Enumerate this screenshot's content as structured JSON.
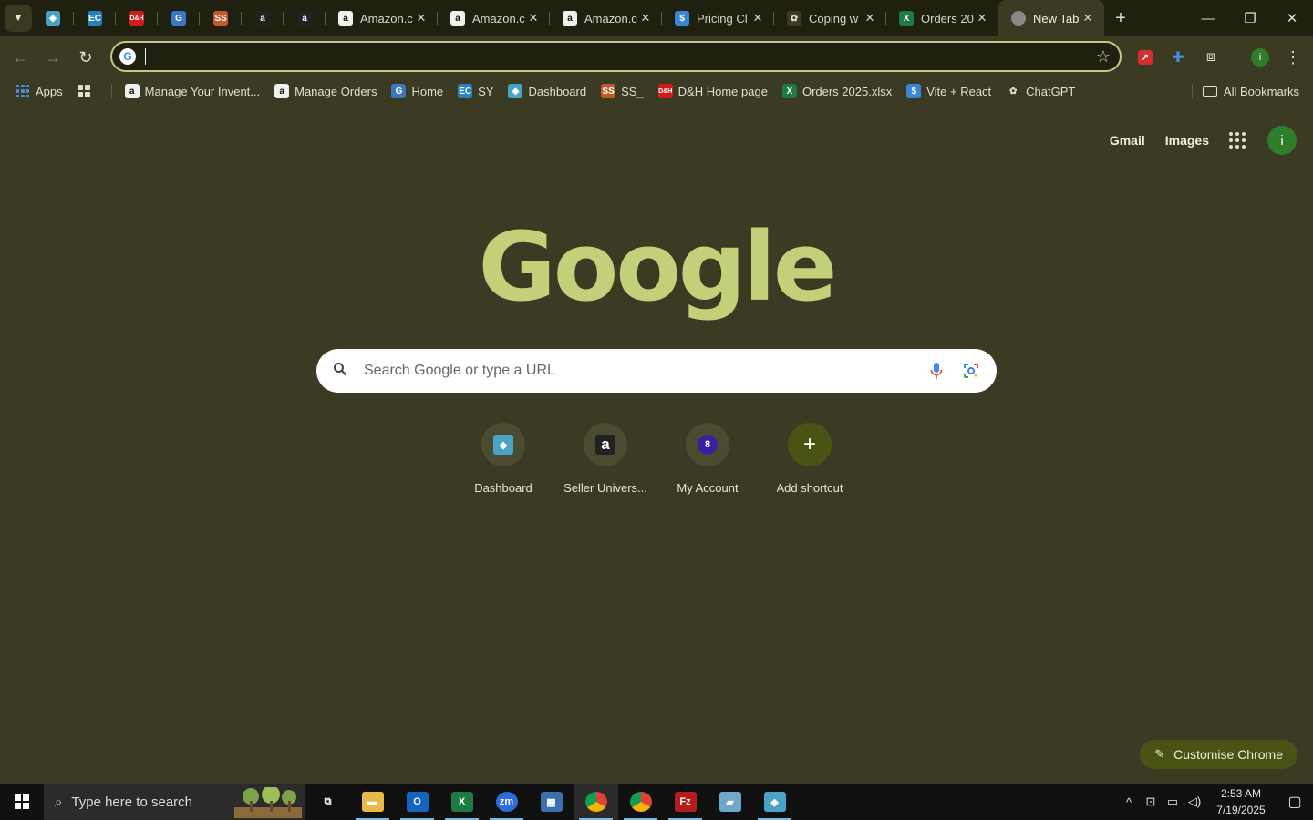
{
  "tabs": {
    "pinned": [
      {
        "icon": "dashboard-diamond-icon",
        "glyph": "◆",
        "color": "#4aa3c7"
      },
      {
        "icon": "ec-icon",
        "glyph": "EC",
        "color": "#2a7fc1"
      },
      {
        "icon": "dh-icon",
        "glyph": "D&H",
        "color": "#d01c1c"
      },
      {
        "icon": "home-g-icon",
        "glyph": "G",
        "color": "#3a78c3"
      },
      {
        "icon": "ss-icon",
        "glyph": "SS",
        "color": "#c05a2a"
      },
      {
        "icon": "amazon-icon",
        "glyph": "a",
        "color": "#222222"
      },
      {
        "icon": "amazon-icon",
        "glyph": "a",
        "color": "#222222"
      }
    ],
    "open": [
      {
        "title": "Amazon.c",
        "icon": "amazon-icon",
        "glyph": "a",
        "color": "#f0f0f0",
        "close": "✕"
      },
      {
        "title": "Amazon.c",
        "icon": "amazon-icon",
        "glyph": "a",
        "color": "#f0f0f0",
        "close": "✕"
      },
      {
        "title": "Amazon.c",
        "icon": "amazon-icon",
        "glyph": "a",
        "color": "#f0f0f0",
        "close": "✕"
      },
      {
        "title": "Pricing Cl",
        "icon": "dollar-icon",
        "glyph": "$",
        "color": "#3a86d6",
        "close": "✕"
      },
      {
        "title": "Coping w",
        "icon": "chatgpt-icon",
        "glyph": "✿",
        "color": "#3b3b24",
        "close": "✕"
      },
      {
        "title": "Orders 20",
        "icon": "excel-icon",
        "glyph": "X",
        "color": "#1f7a43",
        "close": "✕"
      }
    ],
    "active": {
      "title": "New Tab",
      "icon": "chrome-icon",
      "close": "✕"
    },
    "new_tab": "+"
  },
  "window": {
    "minimize": "—",
    "restore": "❐",
    "close": "✕"
  },
  "toolbar": {
    "back": "←",
    "forward": "→",
    "reload": "↻",
    "omnibox_value": "",
    "star": "☆"
  },
  "bookmarks": [
    {
      "label": "Apps",
      "type": "apps"
    },
    {
      "label": "",
      "type": "grid"
    },
    {
      "label": "Manage Your Invent...",
      "icon": "amazon-icon",
      "glyph": "a",
      "color": "#f0f0f0"
    },
    {
      "label": "Manage Orders",
      "icon": "amazon-icon",
      "glyph": "a",
      "color": "#f0f0f0"
    },
    {
      "label": "Home",
      "icon": "home-g-icon",
      "glyph": "G",
      "color": "#3a78c3"
    },
    {
      "label": "SY",
      "icon": "ec-icon",
      "glyph": "EC",
      "color": "#2a7fc1"
    },
    {
      "label": "Dashboard",
      "icon": "dashboard-diamond-icon",
      "glyph": "◆",
      "color": "#4aa3c7"
    },
    {
      "label": "SS_",
      "icon": "ss-icon",
      "glyph": "SS",
      "color": "#c05a2a"
    },
    {
      "label": "D&H Home page",
      "icon": "dh-icon",
      "glyph": "D&H",
      "color": "#d01c1c"
    },
    {
      "label": "Orders 2025.xlsx",
      "icon": "excel-icon",
      "glyph": "X",
      "color": "#1f7a43"
    },
    {
      "label": "Vite + React",
      "icon": "dollar-icon",
      "glyph": "$",
      "color": "#3a86d6"
    },
    {
      "label": "ChatGPT",
      "icon": "chatgpt-icon",
      "glyph": "✿",
      "color": "#3b3b24"
    }
  ],
  "all_bookmarks": "All Bookmarks",
  "header_links": {
    "gmail": "Gmail",
    "images": "Images",
    "avatar": "i"
  },
  "logo": "Google",
  "search": {
    "placeholder": "Search Google or type a URL"
  },
  "shortcuts": [
    {
      "label": "Dashboard",
      "icon": "dashboard-diamond-icon",
      "glyph": "◆",
      "color": "#4aa3c7"
    },
    {
      "label": "Seller Univers...",
      "icon": "amazon-icon",
      "glyph": "a",
      "color": "#222222"
    },
    {
      "label": "My Account",
      "icon": "account-8-icon",
      "glyph": "8",
      "color": "#3a1fa0"
    },
    {
      "label": "Add shortcut",
      "icon": "plus-icon",
      "glyph": "+",
      "color": "#4a5214"
    }
  ],
  "customise": "Customise Chrome",
  "taskbar": {
    "search_placeholder": "Type here to search",
    "apps": [
      {
        "icon": "task-view-icon",
        "glyph": "⧉",
        "color": "#101010"
      },
      {
        "icon": "file-explorer-icon",
        "glyph": "▬",
        "color": "#e8b84a"
      },
      {
        "icon": "outlook-icon",
        "glyph": "O",
        "color": "#1565c0"
      },
      {
        "icon": "excel-icon",
        "glyph": "X",
        "color": "#1f7a43"
      },
      {
        "icon": "zoom-icon",
        "glyph": "zm",
        "color": "#2d6cdf"
      },
      {
        "icon": "calculator-icon",
        "glyph": "▦",
        "color": "#3a6fb0"
      },
      {
        "icon": "chrome-icon",
        "glyph": "◉",
        "color": "#d93025"
      },
      {
        "icon": "chrome-icon",
        "glyph": "◉",
        "color": "#d93025"
      },
      {
        "icon": "filezilla-icon",
        "glyph": "Fz",
        "color": "#b51d1d"
      },
      {
        "icon": "notes-icon",
        "glyph": "▰",
        "color": "#6fa8c9"
      },
      {
        "icon": "dashboard-diamond-icon",
        "glyph": "◆",
        "color": "#4aa3c7"
      }
    ],
    "time": "2:53 AM",
    "date": "7/19/2025"
  }
}
